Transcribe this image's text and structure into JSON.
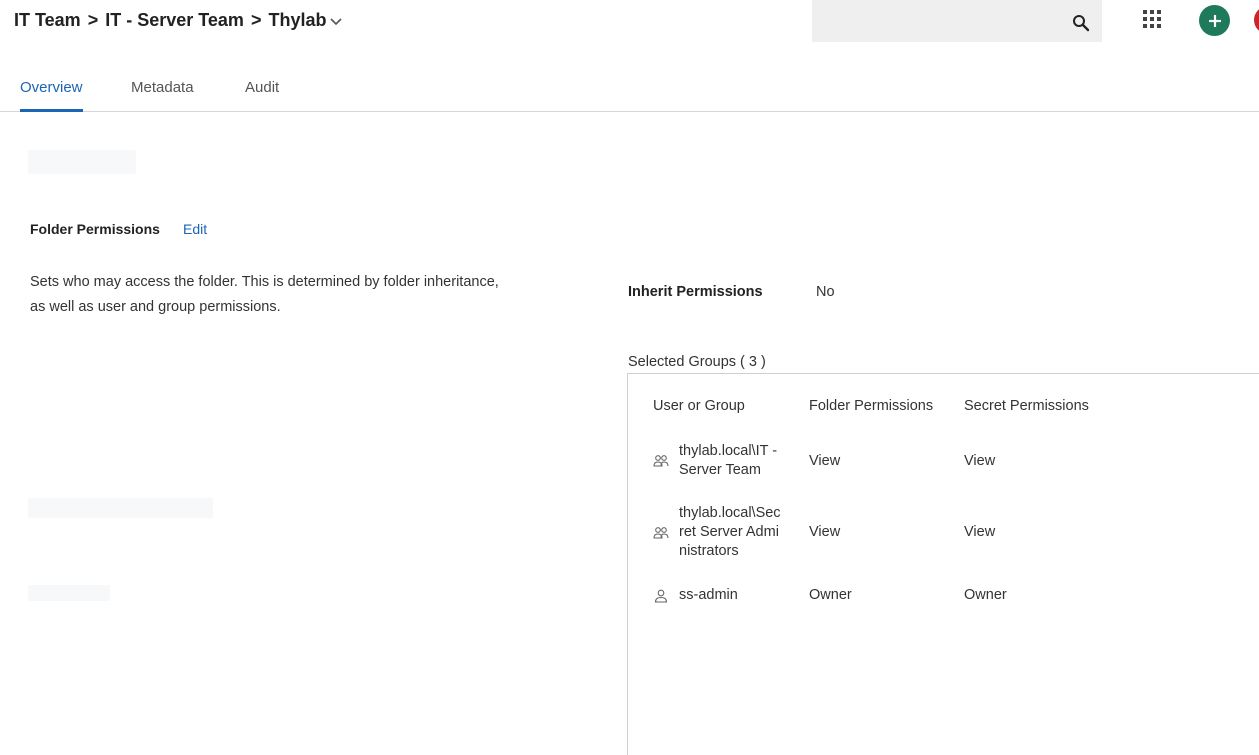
{
  "header": {
    "breadcrumb": [
      "IT Team",
      "IT - Server Team",
      "Thylab"
    ],
    "separator": ">",
    "search_placeholder": ""
  },
  "tabs": [
    {
      "label": "Overview",
      "active": true
    },
    {
      "label": "Metadata",
      "active": false
    },
    {
      "label": "Audit",
      "active": false
    }
  ],
  "folder_permissions": {
    "title": "Folder Permissions",
    "edit_label": "Edit",
    "description": "Sets who may access the folder. This is determined by folder inheritance, as well as user and group permissions."
  },
  "inherit": {
    "label": "Inherit Permissions",
    "value": "No"
  },
  "groups": {
    "label": "Selected Groups ( 3 )",
    "columns": [
      "User or Group",
      "Folder Permissions",
      "Secret Permissions"
    ],
    "rows": [
      {
        "name_lines": [
          "thylab.local\\IT -",
          "Server Team"
        ],
        "type_icon": "group-icon",
        "folder": "View",
        "secret": "View"
      },
      {
        "name_lines": [
          "thylab.local\\Sec",
          "ret Server Admi",
          "nistrators"
        ],
        "type_icon": "group-icon",
        "folder": "View",
        "secret": "View"
      },
      {
        "name_lines": [
          "ss-admin"
        ],
        "type_icon": "user-icon",
        "folder": "Owner",
        "secret": "Owner"
      }
    ]
  },
  "colors": {
    "accent": "#1c64b4",
    "add_button": "#1e7a5a"
  }
}
